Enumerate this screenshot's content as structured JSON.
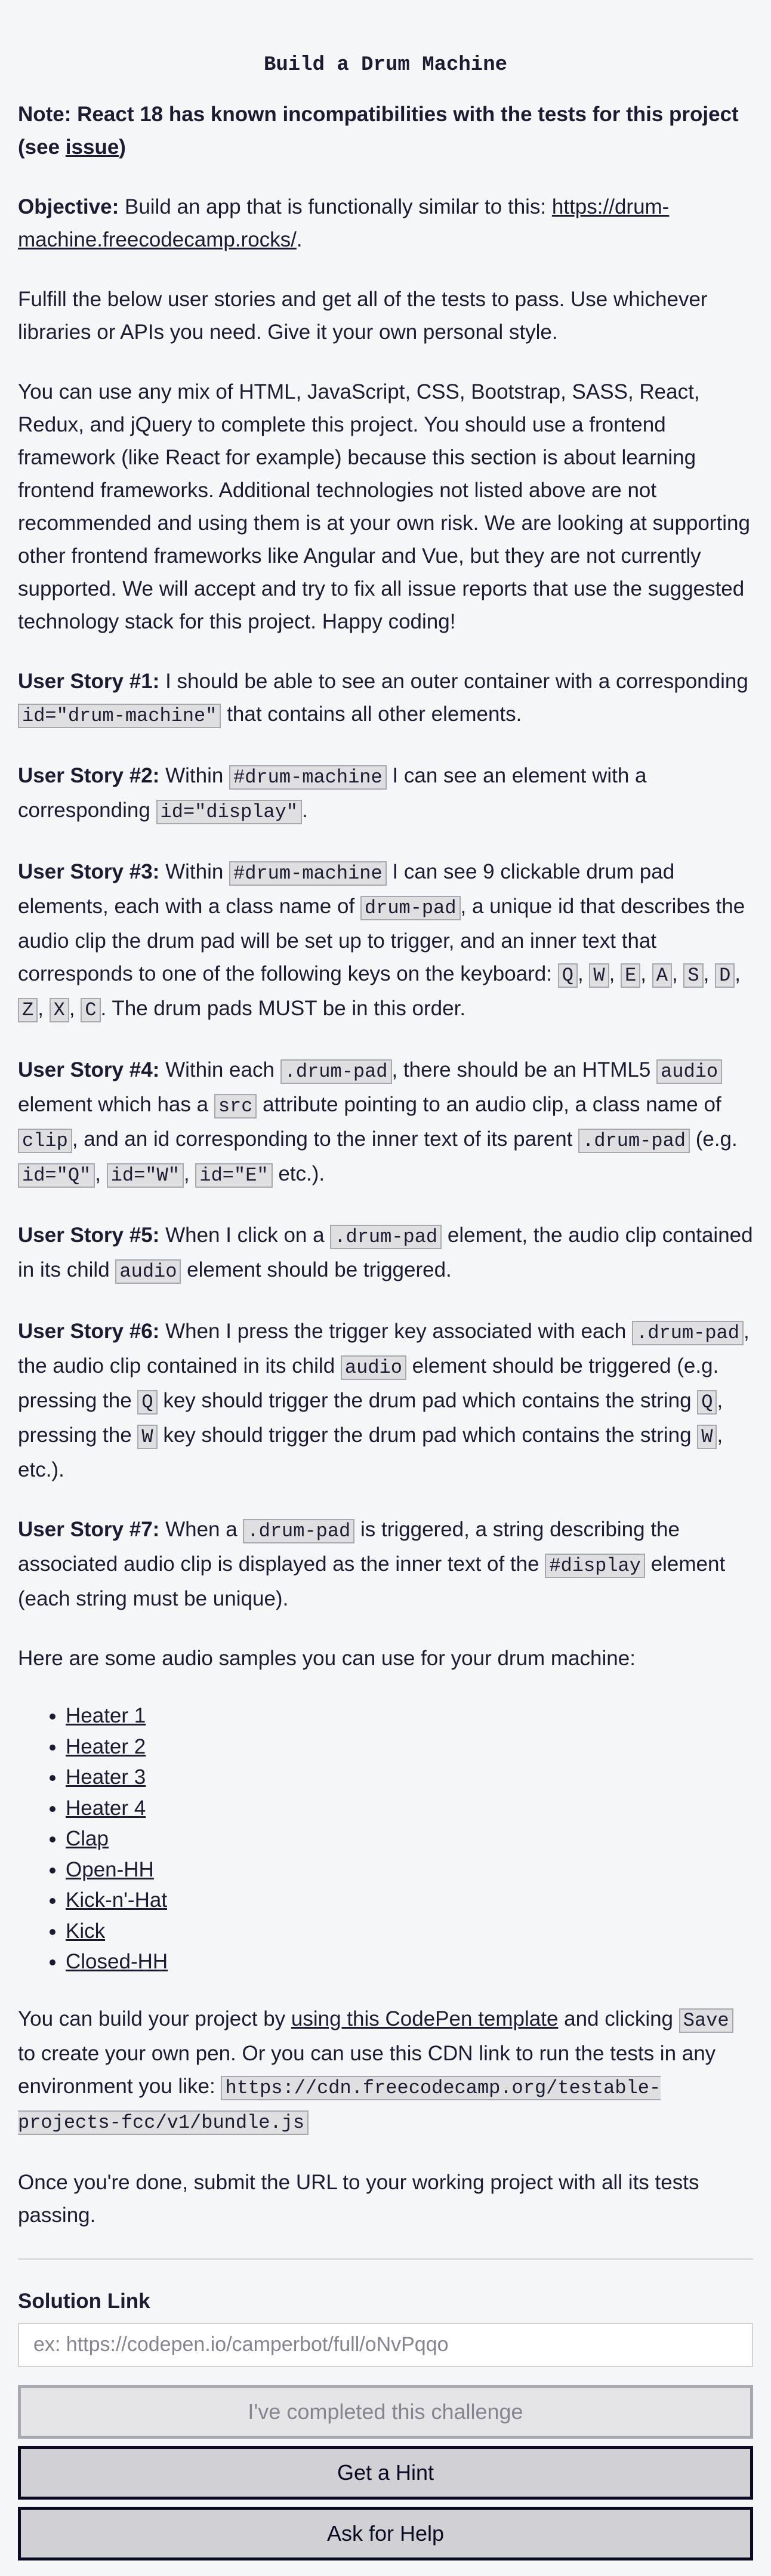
{
  "page_title": "Build a Drum Machine",
  "note": {
    "label": "Note: React 18 has known incompatibilities with the tests for this project (see",
    "link_text": "issue",
    "suffix": ")"
  },
  "objective": {
    "label": "Objective:",
    "text": "Build an app that is functionally similar to this:",
    "link_text": "https://drum-machine.freecodecamp.rocks/",
    "suffix": "."
  },
  "intro_1": "Fulfill the below user stories and get all of the tests to pass. Use whichever libraries or APIs you need. Give it your own personal style.",
  "intro_2": "You can use any mix of HTML, JavaScript, CSS, Bootstrap, SASS, React, Redux, and jQuery to complete this project. You should use a frontend framework (like React for example) because this section is about learning frontend frameworks. Additional technologies not listed above are not recommended and using them is at your own risk. We are looking at supporting other frontend frameworks like Angular and Vue, but they are not currently supported. We will accept and try to fix all issue reports that use the suggested technology stack for this project. Happy coding!",
  "stories": {
    "s1": {
      "label": "User Story #1:",
      "t1": "I should be able to see an outer container with a corresponding",
      "c1": "id=\"drum-machine\"",
      "t2": "that contains all other elements."
    },
    "s2": {
      "label": "User Story #2:",
      "t1": "Within",
      "c1": "#drum-machine",
      "t2": "I can see an element with a corresponding",
      "c2": "id=\"display\"",
      "t3": "."
    },
    "s3": {
      "label": "User Story #3:",
      "t1": "Within",
      "c1": "#drum-machine",
      "t2": "I can see 9 clickable drum pad elements, each with a class name of",
      "c2": "drum-pad",
      "t3": ", a unique id that describes the audio clip the drum pad will be set up to trigger, and an inner text that corresponds to one of the following keys on the keyboard:",
      "keys": [
        "Q",
        "W",
        "E",
        "A",
        "S",
        "D",
        "Z",
        "X",
        "C"
      ],
      "sep": ",",
      "t4": ". The drum pads MUST be in this order."
    },
    "s4": {
      "label": "User Story #4:",
      "t1": "Within each",
      "c1": ".drum-pad",
      "t2": ", there should be an HTML5",
      "c2": "audio",
      "t3": "element which has a",
      "c3": "src",
      "t4": "attribute pointing to an audio clip, a class name of",
      "c4": "clip",
      "t5": ", and an id corresponding to the inner text of its parent",
      "c5": ".drum-pad",
      "t6": "(e.g.",
      "c6": "id=\"Q\"",
      "t7": ",",
      "c7": "id=\"W\"",
      "t8": ",",
      "c8": "id=\"E\"",
      "t9": "etc.)."
    },
    "s5": {
      "label": "User Story #5:",
      "t1": "When I click on a",
      "c1": ".drum-pad",
      "t2": "element, the audio clip contained in its child",
      "c2": "audio",
      "t3": "element should be triggered."
    },
    "s6": {
      "label": "User Story #6:",
      "t1": "When I press the trigger key associated with each",
      "c1": ".drum-pad",
      "t2": ", the audio clip contained in its child",
      "c2": "audio",
      "t3": "element should be triggered (e.g. pressing the",
      "c3": "Q",
      "t4": "key should trigger the drum pad which contains the string",
      "c4": "Q",
      "t5": ", pressing the",
      "c5": "W",
      "t6": "key should trigger the drum pad which contains the string",
      "c6": "W",
      "t7": ", etc.)."
    },
    "s7": {
      "label": "User Story #7:",
      "t1": "When a",
      "c1": ".drum-pad",
      "t2": "is triggered, a string describing the associated audio clip is displayed as the inner text of the",
      "c2": "#display",
      "t3": "element (each string must be unique)."
    }
  },
  "samples_intro": "Here are some audio samples you can use for your drum machine:",
  "samples": [
    "Heater 1",
    "Heater 2",
    "Heater 3",
    "Heater 4",
    "Clap",
    "Open-HH",
    "Kick-n'-Hat",
    "Kick",
    "Closed-HH"
  ],
  "build": {
    "t1": "You can build your project by",
    "link_text": "using this CodePen template",
    "t2": "and clicking",
    "c1": "Save",
    "t3": "to create your own pen. Or you can use this CDN link to run the tests in any environment you like:",
    "c2": "https://cdn.freecodecamp.org/testable-projects-fcc/v1/bundle.js"
  },
  "submit_text": "Once you're done, submit the URL to your working project with all its tests passing.",
  "solution": {
    "label": "Solution Link",
    "placeholder": "ex: https://codepen.io/camperbot/full/oNvPqqo",
    "value": ""
  },
  "buttons": {
    "complete": "I've completed this challenge",
    "hint": "Get a Hint",
    "help": "Ask for Help"
  }
}
